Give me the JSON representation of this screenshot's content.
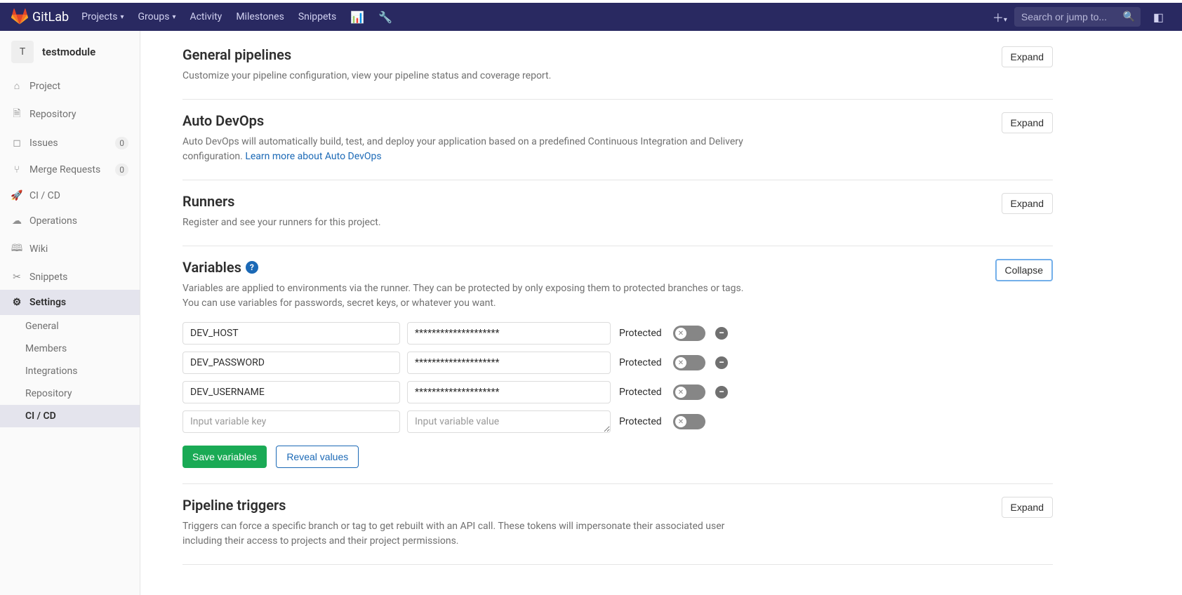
{
  "brand": "GitLab",
  "navbar": {
    "items": [
      "Projects",
      "Groups",
      "Activity",
      "Milestones",
      "Snippets"
    ],
    "search_placeholder": "Search or jump to..."
  },
  "project": {
    "initial": "T",
    "name": "testmodule"
  },
  "sidebar": {
    "items": [
      {
        "icon": "home",
        "label": "Project"
      },
      {
        "icon": "repo",
        "label": "Repository"
      },
      {
        "icon": "issues",
        "label": "Issues",
        "badge": "0"
      },
      {
        "icon": "merge",
        "label": "Merge Requests",
        "badge": "0"
      },
      {
        "icon": "rocket",
        "label": "CI / CD"
      },
      {
        "icon": "ops",
        "label": "Operations"
      },
      {
        "icon": "wiki",
        "label": "Wiki"
      },
      {
        "icon": "snip",
        "label": "Snippets"
      },
      {
        "icon": "gear",
        "label": "Settings",
        "active": true
      }
    ],
    "sub": [
      "General",
      "Members",
      "Integrations",
      "Repository",
      "CI / CD"
    ],
    "sub_active": 4
  },
  "sections": {
    "general": {
      "title": "General pipelines",
      "desc": "Customize your pipeline configuration, view your pipeline status and coverage report.",
      "btn": "Expand"
    },
    "autodevops": {
      "title": "Auto DevOps",
      "desc": "Auto DevOps will automatically build, test, and deploy your application based on a predefined Continuous Integration and Delivery configuration. ",
      "link": "Learn more about Auto DevOps",
      "btn": "Expand"
    },
    "runners": {
      "title": "Runners",
      "desc": "Register and see your runners for this project.",
      "btn": "Expand"
    },
    "variables": {
      "title": "Variables",
      "desc": "Variables are applied to environments via the runner. They can be protected by only exposing them to protected branches or tags. You can use variables for passwords, secret keys, or whatever you want.",
      "btn": "Collapse",
      "rows": [
        {
          "key": "DEV_HOST",
          "value": "********************",
          "protected_label": "Protected"
        },
        {
          "key": "DEV_PASSWORD",
          "value": "********************",
          "protected_label": "Protected"
        },
        {
          "key": "DEV_USERNAME",
          "value": "********************",
          "protected_label": "Protected"
        }
      ],
      "new_row": {
        "key_placeholder": "Input variable key",
        "value_placeholder": "Input variable value",
        "protected_label": "Protected"
      },
      "save_btn": "Save variables",
      "reveal_btn": "Reveal values"
    },
    "triggers": {
      "title": "Pipeline triggers",
      "desc": "Triggers can force a specific branch or tag to get rebuilt with an API call. These tokens will impersonate their associated user including their access to projects and their project permissions.",
      "btn": "Expand"
    }
  }
}
